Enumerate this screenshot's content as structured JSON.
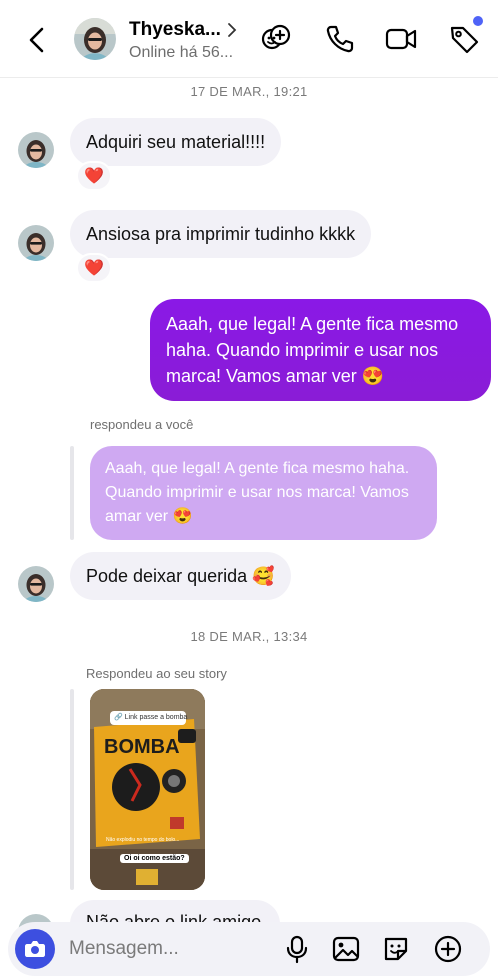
{
  "header": {
    "back_icon": "chevron-left-icon",
    "name": "Thyeska...",
    "status": "Online há 56...",
    "actions": [
      "group-add-icon",
      "phone-icon",
      "video-icon",
      "tag-icon"
    ],
    "badge_color": "#4f63f7"
  },
  "chat": {
    "timestamp_1": "17 DE MAR., 19:21",
    "msg_1": "Adquiri seu material!!!!",
    "msg_1_reaction": "❤️",
    "msg_2": "Ansiosa pra imprimir tudinho kkkk",
    "msg_2_reaction": "❤️",
    "msg_out": "Aaah, que legal! A gente fica mesmo haha. Quando imprimir e usar nos marca! Vamos amar ver 😍",
    "reply_label": "respondeu a você",
    "quoted": "Aaah, que legal! A gente fica mesmo haha. Quando imprimir e usar nos marca! Vamos amar ver 😍",
    "msg_3": "Pode deixar querida 🥰",
    "timestamp_2": "18 DE MAR., 13:34",
    "story_label": "Respondeu ao seu story",
    "story": {
      "link_chip": "🔗 Link passe a bomba",
      "caption": "Oi oi como estão?",
      "subtitle": "Não explodiu no tempo do bolo..."
    },
    "msg_4_partial": "Não abre o link amigo"
  },
  "composer": {
    "placeholder": "Mensagem...",
    "icons": [
      "camera-icon",
      "mic-icon",
      "gallery-icon",
      "sticker-icon",
      "plus-icon"
    ],
    "accent": "#3d4fe0"
  },
  "colors": {
    "outgoing_bubble": "#8a19e6",
    "incoming_bubble": "#f2f1f7",
    "quoted_bubble": "#cfa9f2"
  }
}
